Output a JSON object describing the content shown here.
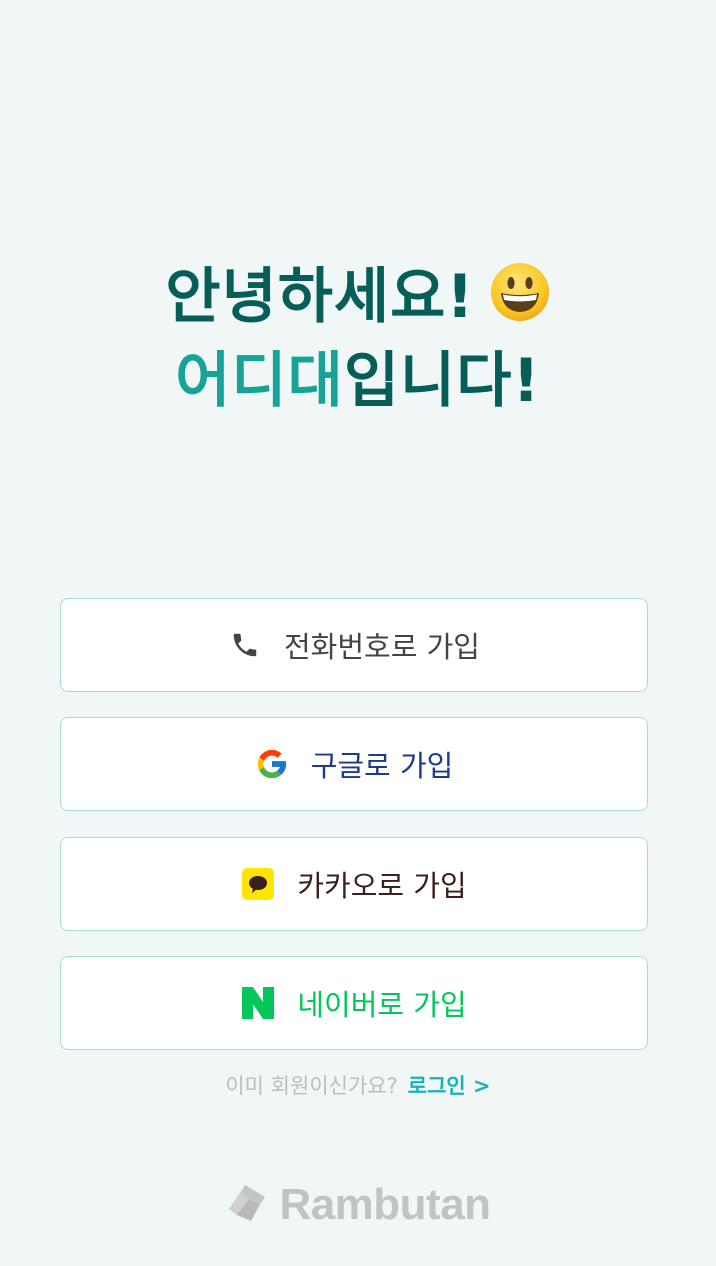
{
  "greeting": {
    "line1": "안녕하세요!",
    "line2_accent": "어디대",
    "line2_rest": "입니다!"
  },
  "buttons": {
    "phone": {
      "label": "전화번호로 가입",
      "icon": "phone-icon",
      "color": "#333333"
    },
    "google": {
      "label": "구글로 가입",
      "icon": "google-logo-icon",
      "color": "#1e3a8a"
    },
    "kakao": {
      "label": "카카오로 가입",
      "icon": "kakao-talk-icon",
      "color": "#3b1e1e"
    },
    "naver": {
      "label": "네이버로 가입",
      "icon": "naver-logo-icon",
      "color": "#03c75a"
    }
  },
  "login": {
    "question": "이미 회원이신가요?",
    "link": "로그인 >"
  },
  "footer": {
    "brand": "Rambutan"
  },
  "colors": {
    "background": "#f1f7f7",
    "heading_dark": "#075e58",
    "heading_accent": "#17a398",
    "button_border": "#a9dcd6",
    "link": "#17b3b8"
  }
}
